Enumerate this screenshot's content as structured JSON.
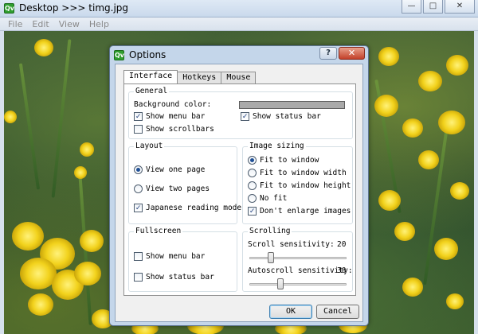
{
  "main_window": {
    "title": "Desktop >>> timg.jpg",
    "app_icon": "Qv",
    "controls": {
      "minimize": "—",
      "maximize": "□",
      "close": "✕"
    }
  },
  "menubar": {
    "items": [
      "File",
      "Edit",
      "View",
      "Help"
    ]
  },
  "dialog": {
    "title": "Options",
    "icon": "Qv",
    "help_glyph": "?",
    "close_glyph": "✕",
    "tabs": [
      "Interface",
      "Hotkeys",
      "Mouse"
    ],
    "active_tab": "Interface",
    "general": {
      "label": "General",
      "background_color_label": "Background color:",
      "background_color": "#a9a9a9",
      "show_menu_bar": {
        "label": "Show menu bar",
        "checked": true
      },
      "show_status_bar": {
        "label": "Show status bar",
        "checked": true
      },
      "show_scrollbars": {
        "label": "Show scrollbars",
        "checked": false
      }
    },
    "layout": {
      "label": "Layout",
      "view_one_page": {
        "label": "View one page",
        "selected": true
      },
      "view_two_pages": {
        "label": "View two pages",
        "selected": false
      },
      "japanese_reading_mode": {
        "label": "Japanese reading mode",
        "checked": true
      }
    },
    "image_sizing": {
      "label": "Image sizing",
      "fit_to_window": {
        "label": "Fit to window",
        "selected": true
      },
      "fit_to_window_width": {
        "label": "Fit to window width",
        "selected": false
      },
      "fit_to_window_height": {
        "label": "Fit to window height",
        "selected": false
      },
      "no_fit": {
        "label": "No fit",
        "selected": false
      },
      "dont_enlarge_images": {
        "label": "Don't enlarge images",
        "checked": true
      }
    },
    "fullscreen": {
      "label": "Fullscreen",
      "show_menu_bar": {
        "label": "Show menu bar",
        "checked": false
      },
      "show_status_bar": {
        "label": "Show status bar",
        "checked": false
      }
    },
    "scrolling": {
      "label": "Scrolling",
      "scroll_sensitivity": {
        "label": "Scroll sensitivity:",
        "value": "20",
        "fraction": 0.22
      },
      "autoscroll_sensitivity": {
        "label": "Autoscroll sensitivity:",
        "value": "30",
        "fraction": 0.32
      }
    },
    "ok_label": "OK",
    "cancel_label": "Cancel"
  },
  "colors": {
    "accent": "#1f4f95",
    "title_bar": "#c9d9ec",
    "dialog_frame": "#c4d6ea"
  }
}
